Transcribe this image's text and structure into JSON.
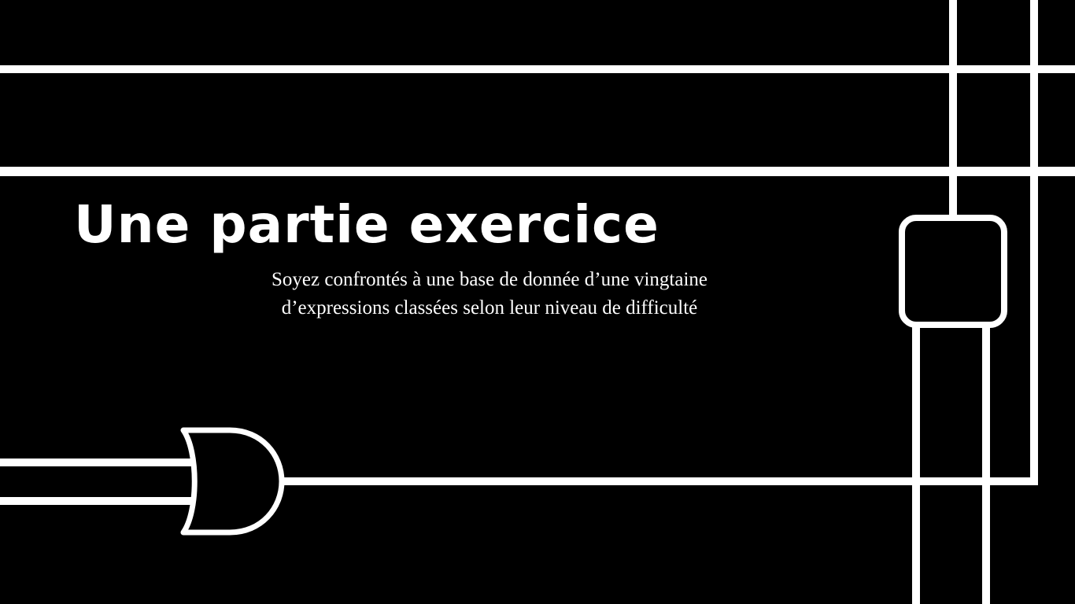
{
  "slide": {
    "title": "Une partie exercice",
    "subtitle_lines": [
      "Soyez confrontés à une base de donnée d’une vingtaine",
      "d’expressions classées selon leur niveau de difficulté"
    ]
  },
  "colors": {
    "background": "#000000",
    "foreground": "#ffffff"
  },
  "icons": {
    "gate_left": "or-gate-icon",
    "gate_right": "buffer-gate-icon"
  }
}
